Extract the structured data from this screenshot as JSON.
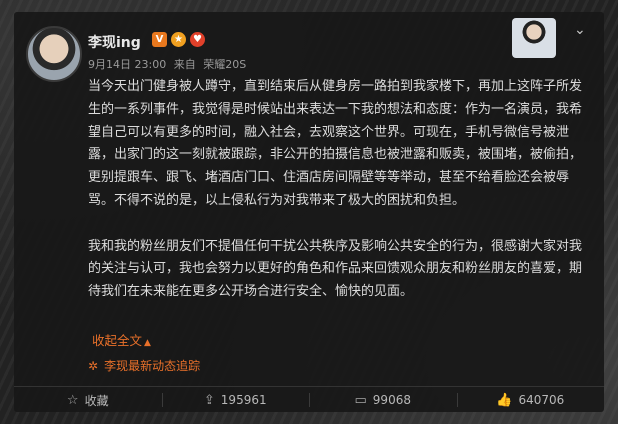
{
  "post": {
    "author": "李现ing",
    "badges": [
      "V",
      "★",
      "♥"
    ],
    "meta": {
      "time": "9月14日 23:00",
      "source_prefix": "来自",
      "source": "荣耀20S"
    },
    "paragraphs": [
      "当今天出门健身被人蹲守，直到结束后从健身房一路拍到我家楼下，再加上这阵子所发生的一系列事件，我觉得是时候站出来表达一下我的想法和态度：作为一名演员，我希望自己可以有更多的时间，融入社会，去观察这个世界。可现在，手机号微信号被泄露，出家门的这一刻就被跟踪，非公开的拍摄信息也被泄露和贩卖，被围堵，被偷拍，更别提跟车、跟飞、堵酒店门口、住酒店房间隔壁等等举动，甚至不给看脸还会被辱骂。不得不说的是，以上侵私行为对我带来了极大的困扰和负担。",
      "我和我的粉丝朋友们不提倡任何干扰公共秩序及影响公共安全的行为，很感谢大家对我的关注与认可，我也会努力以更好的角色和作品来回馈观众朋友和粉丝朋友的喜爱，期待我们在未来能在更多公开场合进行安全、愉快的见面。"
    ],
    "collapse_label": "收起全文",
    "trace_label": "李现最新动态追踪"
  },
  "actions": {
    "favorite_label": "收藏",
    "repost_count": "195961",
    "comment_count": "99068",
    "like_count": "640706"
  }
}
